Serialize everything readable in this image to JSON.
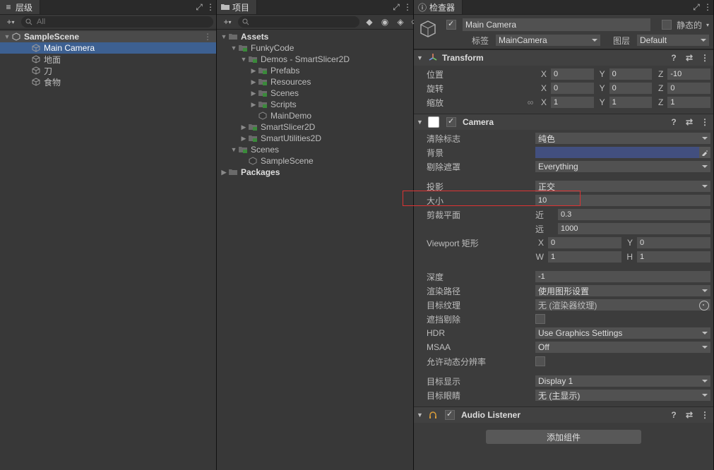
{
  "hierarchy": {
    "title": "层级",
    "search_placeholder": "All",
    "scene": "SampleScene",
    "items": [
      "Main Camera",
      "地面",
      "刀",
      "食物"
    ],
    "selected": "Main Camera"
  },
  "project": {
    "title": "项目",
    "icon_count": "21",
    "tree": [
      {
        "d": 0,
        "open": true,
        "ico": "folder",
        "lbl": "Assets",
        "bold": true
      },
      {
        "d": 1,
        "open": true,
        "ico": "folder",
        "lbl": "FunkyCode"
      },
      {
        "d": 2,
        "open": true,
        "ico": "folder",
        "lbl": "Demos - SmartSlicer2D"
      },
      {
        "d": 3,
        "open": false,
        "ico": "folder",
        "lbl": "Prefabs"
      },
      {
        "d": 3,
        "open": false,
        "ico": "folder",
        "lbl": "Resources"
      },
      {
        "d": 3,
        "open": false,
        "ico": "folder",
        "lbl": "Scenes"
      },
      {
        "d": 3,
        "open": false,
        "ico": "folder",
        "lbl": "Scripts"
      },
      {
        "d": 3,
        "open": null,
        "ico": "scene",
        "lbl": "MainDemo"
      },
      {
        "d": 2,
        "open": false,
        "ico": "folder",
        "lbl": "SmartSlicer2D"
      },
      {
        "d": 2,
        "open": false,
        "ico": "folder",
        "lbl": "SmartUtilities2D"
      },
      {
        "d": 1,
        "open": true,
        "ico": "folder",
        "lbl": "Scenes"
      },
      {
        "d": 2,
        "open": null,
        "ico": "scene",
        "lbl": "SampleScene"
      },
      {
        "d": 0,
        "open": false,
        "ico": "folder",
        "lbl": "Packages",
        "bold": true
      }
    ]
  },
  "inspector": {
    "title": "检查器",
    "object": {
      "enabled": true,
      "name": "Main Camera",
      "static_label": "静态的"
    },
    "tag_label": "标签",
    "tag_value": "MainCamera",
    "layer_label": "图层",
    "layer_value": "Default",
    "transform": {
      "title": "Transform",
      "rows": [
        {
          "lbl": "位置",
          "x": "0",
          "y": "0",
          "z": "-10"
        },
        {
          "lbl": "旋转",
          "x": "0",
          "y": "0",
          "z": "0"
        },
        {
          "lbl": "缩放",
          "x": "1",
          "y": "1",
          "z": "1",
          "linked": true
        }
      ]
    },
    "camera": {
      "title": "Camera",
      "clear_flags": {
        "lbl": "清除标志",
        "val": "纯色"
      },
      "background": {
        "lbl": "背景",
        "color": "#424f7f"
      },
      "culling": {
        "lbl": "剔除遮罩",
        "val": "Everything"
      },
      "projection": {
        "lbl": "投影",
        "val": "正交"
      },
      "size": {
        "lbl": "大小",
        "val": "10"
      },
      "clip": {
        "lbl": "剪裁平面",
        "near_lbl": "近",
        "near": "0.3",
        "far_lbl": "远",
        "far": "1000"
      },
      "viewport": {
        "lbl": "Viewport 矩形",
        "x": "0",
        "y": "0",
        "w": "1",
        "h": "1"
      },
      "depth": {
        "lbl": "深度",
        "val": "-1"
      },
      "render_path": {
        "lbl": "渲染路径",
        "val": "使用图形设置"
      },
      "target_tex": {
        "lbl": "目标纹理",
        "val": "无 (渲染器纹理)"
      },
      "occlusion": {
        "lbl": "遮挡剔除"
      },
      "hdr": {
        "lbl": "HDR",
        "val": "Use Graphics Settings"
      },
      "msaa": {
        "lbl": "MSAA",
        "val": "Off"
      },
      "dyn_res": {
        "lbl": "允许动态分辨率"
      },
      "target_display": {
        "lbl": "目标显示",
        "val": "Display 1"
      },
      "target_eye": {
        "lbl": "目标眼睛",
        "val": "无 (主显示)"
      }
    },
    "audio": {
      "title": "Audio Listener"
    },
    "add_component": "添加组件"
  }
}
